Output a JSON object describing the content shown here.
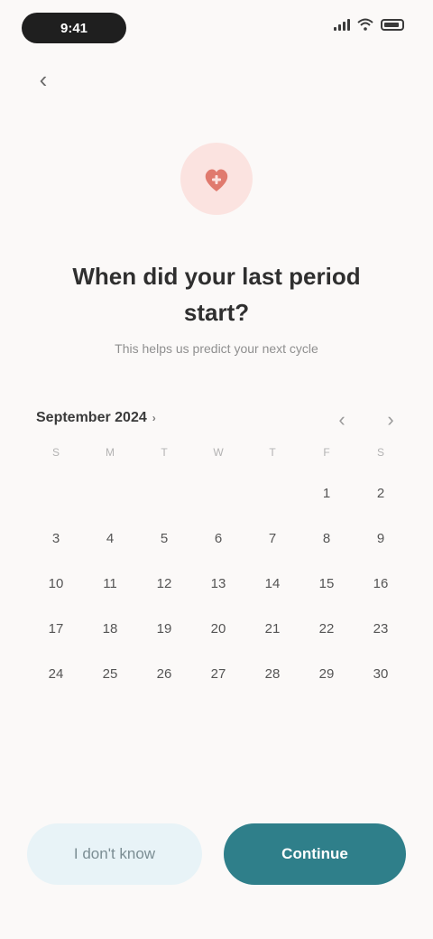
{
  "status_bar": {
    "time": "9:41",
    "icons": [
      "signal-icon",
      "wifi-icon",
      "battery-icon"
    ]
  },
  "back": {
    "icon": "chevron-left-icon",
    "glyph": "‹"
  },
  "hero": {
    "icon": "calendar-heart-icon",
    "accent": "#e07a6e"
  },
  "headline": "When did your last period start?",
  "subtext": "This helps us predict your next cycle",
  "calendar": {
    "month": "September 2024",
    "prev_glyph": "‹",
    "next_glyph": "›",
    "weekdays": [
      "S",
      "M",
      "T",
      "W",
      "T",
      "F",
      "S"
    ],
    "days": [
      "1",
      "2",
      "3",
      "4",
      "5",
      "6",
      "7",
      "8",
      "9",
      "10",
      "11",
      "12",
      "13",
      "14",
      "15",
      "16",
      "17",
      "18",
      "19",
      "20",
      "21",
      "22",
      "23",
      "24",
      "25",
      "26",
      "27",
      "28",
      "29",
      "30"
    ]
  },
  "actions": {
    "secondary": "I don't know",
    "primary": "Continue"
  },
  "colors": {
    "background": "#fbf9f8",
    "primary": "#2f7f8a",
    "secondary": "#e8f3f7",
    "hero_bg": "#fbe3e0"
  }
}
